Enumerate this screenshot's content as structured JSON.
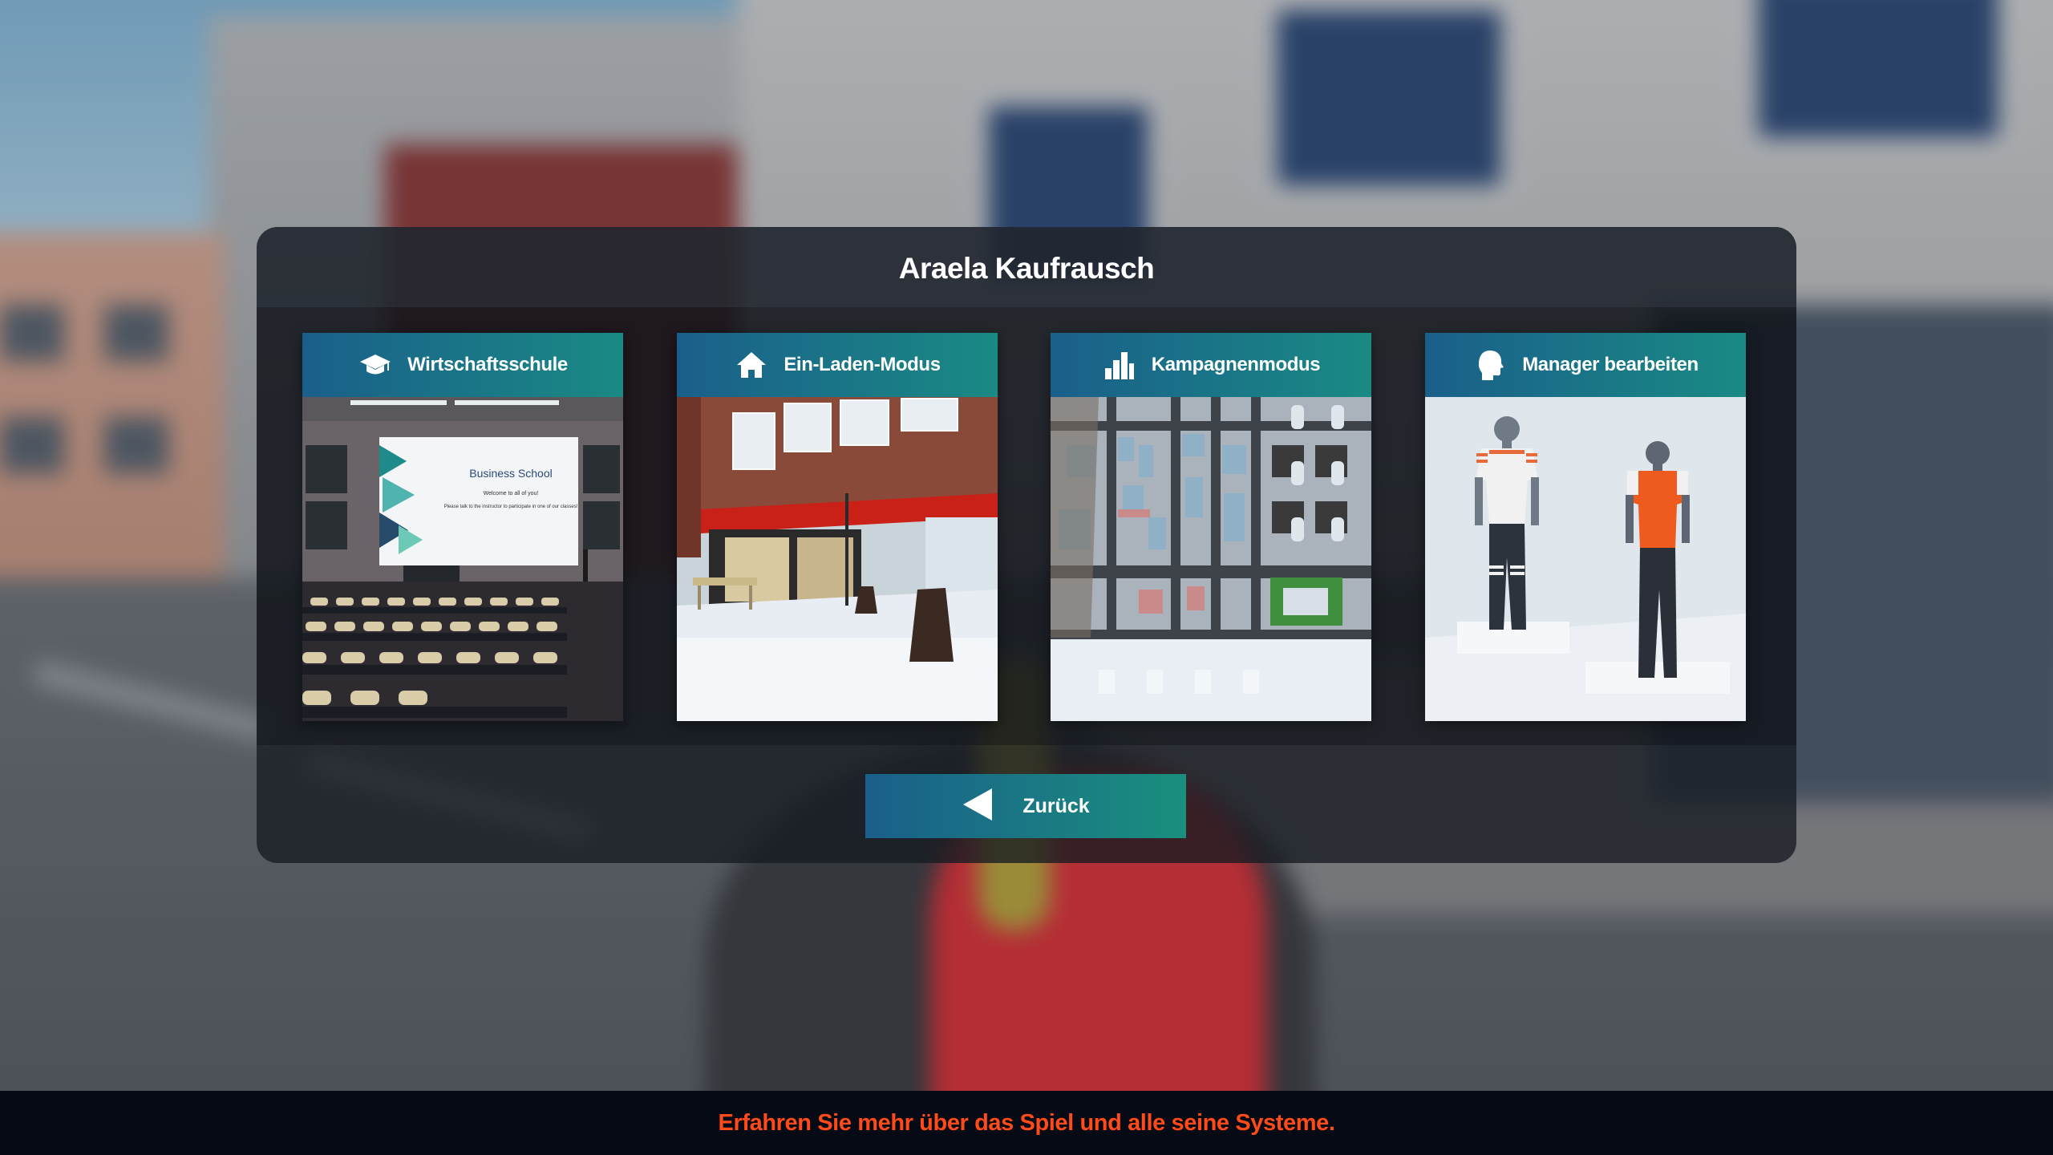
{
  "title": "Araela Kaufrausch",
  "modes": [
    {
      "label": "Wirtschaftsschule",
      "icon": "graduation-cap-icon",
      "preview": {
        "heading": "Business School",
        "sub": "Welcome to all of you!",
        "body": "Please talk to the instructor to participate in one of our classes!"
      }
    },
    {
      "label": "Ein-Laden-Modus",
      "icon": "house-icon"
    },
    {
      "label": "Kampagnenmodus",
      "icon": "city-buildings-icon"
    },
    {
      "label": "Manager bearbeiten",
      "icon": "head-silhouette-icon"
    }
  ],
  "back_button": {
    "label": "Zurück",
    "icon": "triangle-left-icon"
  },
  "info_bar": {
    "text": "Erfahren Sie mehr über das Spiel und alle seine Systeme."
  },
  "colors": {
    "button_gradient_start": "#1a5f8a",
    "button_gradient_end": "#1a8a84",
    "info_text": "#ff4a1a"
  }
}
